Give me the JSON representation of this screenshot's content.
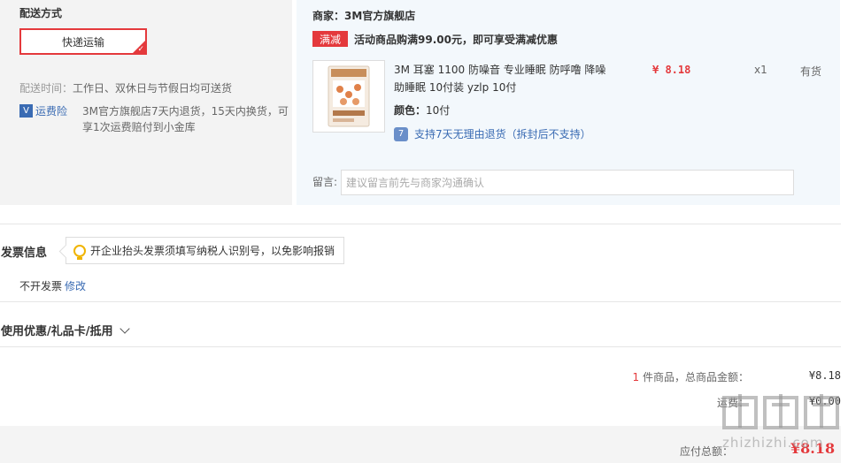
{
  "shipping": {
    "title": "配送方式",
    "option": "快递运输",
    "time_label": "配送时间：",
    "time_value": "工作日、双休日与节假日均可送货",
    "insurance_badge": "V",
    "insurance_label": "运费险",
    "insurance_desc": "3M官方旗舰店7天内退货，15天内换货，可享1次运费赔付到小金库"
  },
  "store": {
    "name": "商家：3M官方旗舰店",
    "promo_tag": "满减",
    "promo_text": "活动商品购满99.00元，即可享受满减优惠"
  },
  "product": {
    "title": "3M 耳塞 1100 防噪音 专业睡眠 防呼噜 降噪助睡眠 10付装 yzlp 10付",
    "color_label": "颜色：",
    "color_value": "10付",
    "return_icon": "7",
    "return_text": "支持7天无理由退货（拆封后不支持）",
    "price": "¥ 8.18",
    "qty": "x1",
    "stock": "有货"
  },
  "note": {
    "label": "留言:",
    "placeholder": "建议留言前先与商家沟通确认"
  },
  "invoice": {
    "title": "发票信息",
    "tip": "开企业抬头发票须填写纳税人识别号，以免影响报销",
    "state": "不开发票",
    "edit": "修改"
  },
  "coupon": {
    "title": "使用优惠/礼品卡/抵用"
  },
  "summary": {
    "count": "1",
    "items_label": " 件商品，总商品金额：",
    "items_amount": "¥8.18",
    "shipping_label": "运费：",
    "shipping_amount": "¥0.00",
    "payable_label": "应付总额：",
    "payable_amount": "¥8.18"
  },
  "watermark": {
    "text": "zhizhizhi.com",
    "icon": "zhi-logo-icon"
  },
  "colors": {
    "accent_red": "#e4393c",
    "link_blue": "#3a6bb3",
    "store_bg": "#f3f8fc",
    "ship_bg": "#f3f3f3"
  }
}
